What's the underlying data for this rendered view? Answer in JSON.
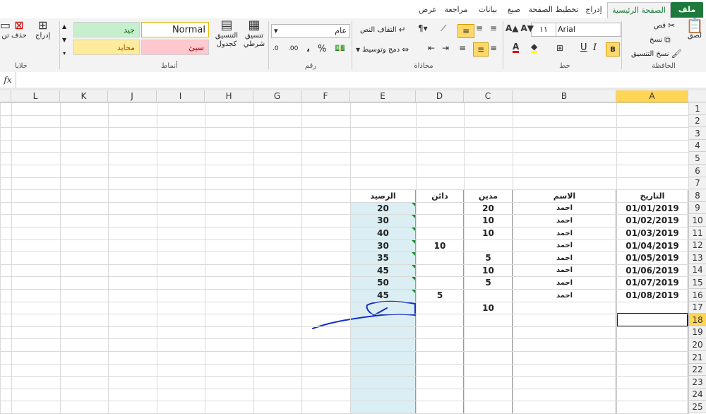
{
  "ribbon_tabs": [
    {
      "label": "ملف",
      "state": "file"
    },
    {
      "label": "الصفحة الرئيسية",
      "state": "active"
    },
    {
      "label": "إدراج",
      "state": "normal"
    },
    {
      "label": "تخطيط الصفحة",
      "state": "normal"
    },
    {
      "label": "صيغ",
      "state": "normal"
    },
    {
      "label": "بيانات",
      "state": "normal"
    },
    {
      "label": "مراجعة",
      "state": "normal"
    },
    {
      "label": "عرض",
      "state": "normal"
    }
  ],
  "clipboard": {
    "paste": "لصق",
    "cut": "قص",
    "copy": "نسخ",
    "format_painter": "نسخ التنسيق",
    "group": "الحافظة"
  },
  "font": {
    "name": "Arial",
    "size": "١١",
    "group": "خط"
  },
  "alignment": {
    "wrap": "التفاف النص",
    "merge": "دمج وتوسيط",
    "group": "محاذاة"
  },
  "number": {
    "format": "عام",
    "percent": "%",
    "comma": "،",
    "inc": ".00",
    "dec": ".0",
    "group": "رقم"
  },
  "styles": {
    "conditional": "تنسيق شرطي",
    "as_table": "التنسيق كجدول",
    "normal": "Normal",
    "good": "جيد",
    "bad": "سيئ",
    "neutral": "محايد",
    "group": "أنماط"
  },
  "cells": {
    "insert": "إدراج",
    "delete": "حذف",
    "format": "تن",
    "group": "خلايا"
  },
  "formula_bar": {
    "fx": "fx",
    "content": ""
  },
  "columns": [
    "A",
    "B",
    "C",
    "D",
    "E",
    "F",
    "G",
    "H",
    "I",
    "J",
    "K",
    "L"
  ],
  "rows": [
    "1",
    "2",
    "3",
    "4",
    "5",
    "6",
    "7",
    "8",
    "9",
    "10",
    "11",
    "12",
    "13",
    "14",
    "15",
    "16",
    "17",
    "18",
    "19",
    "20",
    "21",
    "22",
    "23",
    "24",
    "25"
  ],
  "selected": {
    "column": "A",
    "row": "18"
  },
  "table": {
    "headers": {
      "date": "التاريخ",
      "name": "الاسم",
      "debit": "مدين",
      "credit": "دائن",
      "balance": "الرصيد"
    },
    "rows": [
      {
        "date": "01/01/2019",
        "name": "احمد",
        "debit": "20",
        "credit": "",
        "balance": "20"
      },
      {
        "date": "01/02/2019",
        "name": "احمد",
        "debit": "10",
        "credit": "",
        "balance": "30"
      },
      {
        "date": "01/03/2019",
        "name": "احمد",
        "debit": "10",
        "credit": "",
        "balance": "40"
      },
      {
        "date": "01/04/2019",
        "name": "احمد",
        "debit": "",
        "credit": "10",
        "balance": "30"
      },
      {
        "date": "01/05/2019",
        "name": "احمد",
        "debit": "5",
        "credit": "",
        "balance": "35"
      },
      {
        "date": "01/06/2019",
        "name": "احمد",
        "debit": "10",
        "credit": "",
        "balance": "45"
      },
      {
        "date": "01/07/2019",
        "name": "احمد",
        "debit": "5",
        "credit": "",
        "balance": "50"
      },
      {
        "date": "01/08/2019",
        "name": "احمد",
        "debit": "",
        "credit": "5",
        "balance": "45"
      },
      {
        "date": "",
        "name": "",
        "debit": "10",
        "credit": "",
        "balance": ""
      }
    ]
  },
  "colors": {
    "balance_fill": "#daeef3",
    "annotation_ink": "#1430c8",
    "selection": "#ffd555",
    "file_tab": "#1e7a3c"
  }
}
